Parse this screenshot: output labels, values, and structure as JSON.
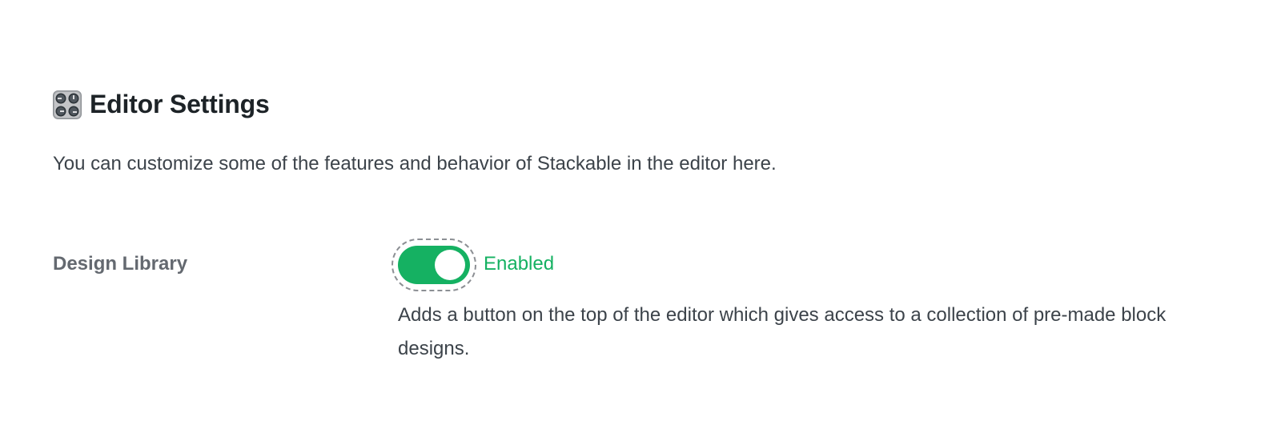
{
  "section": {
    "icon": "control-knobs-icon",
    "title": "Editor Settings",
    "intro": "You can customize some of the features and behavior of Stackable in the editor here."
  },
  "settings": [
    {
      "label": "Design Library",
      "toggle_state": "on",
      "status_text": "Enabled",
      "description": "Adds a button on the top of the editor which gives access to a collection of pre-made block designs."
    }
  ],
  "colors": {
    "accent_green": "#15b162",
    "label_gray": "#646970",
    "text_dark": "#1d2327"
  }
}
